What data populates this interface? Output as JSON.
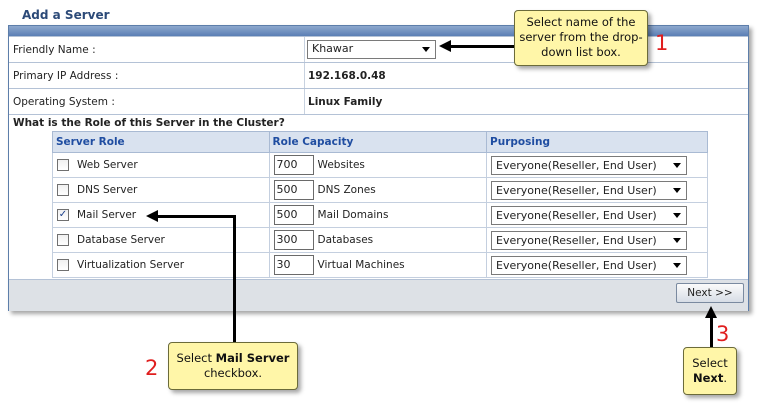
{
  "panel": {
    "title": "Add a Server"
  },
  "form": {
    "friendly_name_label": "Friendly Name :",
    "friendly_name_value": "Khawar",
    "ip_label": "Primary IP Address :",
    "ip_value": "192.168.0.48",
    "os_label": "Operating System :",
    "os_value": "Linux Family",
    "question": "What is the Role of this Server in the Cluster?"
  },
  "table": {
    "headers": [
      "Server Role",
      "Role Capacity",
      "Purposing"
    ],
    "rows": [
      {
        "role": "Web Server",
        "checked": false,
        "capacity": "700",
        "unit": "Websites",
        "purposing": "Everyone(Reseller, End User)"
      },
      {
        "role": "DNS Server",
        "checked": false,
        "capacity": "500",
        "unit": "DNS Zones",
        "purposing": "Everyone(Reseller, End User)"
      },
      {
        "role": "Mail Server",
        "checked": true,
        "capacity": "500",
        "unit": "Mail Domains",
        "purposing": "Everyone(Reseller, End User)"
      },
      {
        "role": "Database Server",
        "checked": false,
        "capacity": "300",
        "unit": "Databases",
        "purposing": "Everyone(Reseller, End User)"
      },
      {
        "role": "Virtualization Server",
        "checked": false,
        "capacity": "30",
        "unit": "Virtual Machines",
        "purposing": "Everyone(Reseller, End User)"
      }
    ]
  },
  "footer": {
    "next_label": "Next >>"
  },
  "callouts": {
    "c1": {
      "number": "1",
      "text": "Select name of the server from the drop-down list box."
    },
    "c2": {
      "number": "2",
      "text_pre": "Select ",
      "text_bold": "Mail Server",
      "text_post": " checkbox."
    },
    "c3": {
      "number": "3",
      "text_pre": "Select ",
      "text_bold": "Next",
      "text_post": "."
    }
  },
  "colors": {
    "callout_bg": "#fff6a8",
    "step_number": "#e01e1e",
    "header_text": "#1f4da1"
  }
}
